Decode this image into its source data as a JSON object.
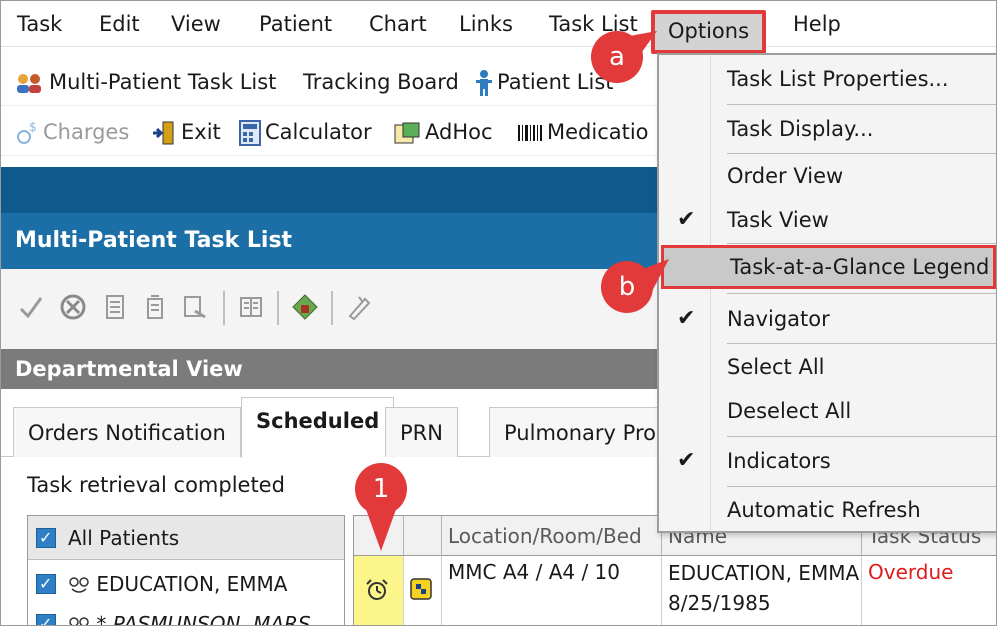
{
  "menubar": {
    "items": [
      "Task",
      "Edit",
      "View",
      "Patient",
      "Chart",
      "Links",
      "Task List",
      "Options",
      "Help"
    ]
  },
  "toolbar1": {
    "multi_patient": "Multi-Patient Task List",
    "tracking_board": "Tracking Board",
    "patient_list": "Patient List"
  },
  "toolbar2": {
    "charges": "Charges",
    "exit": "Exit",
    "calculator": "Calculator",
    "adhoc": "AdHoc",
    "medication": "Medicatio"
  },
  "title_bar": {
    "title": "Multi-Patient Task List"
  },
  "dept_bar": {
    "title": "Departmental View"
  },
  "tabs": [
    "Orders Notification",
    "Scheduled",
    "PRN",
    "Pulmonary Pro"
  ],
  "status": "Task retrieval completed",
  "patients": {
    "all_label": "All Patients",
    "rows": [
      {
        "name": "EDUCATION, EMMA",
        "italic": false
      },
      {
        "name": "* PASMUNSON, MARS",
        "italic": true
      }
    ]
  },
  "grid": {
    "headers": [
      "",
      "",
      "Location/Room/Bed",
      "Name",
      "Task Status"
    ],
    "row": {
      "location": "MMC A4 / A4 / 10",
      "name_line1": "EDUCATION, EMMA",
      "name_line2": "8/25/1985",
      "status": "Overdue"
    }
  },
  "options_menu": {
    "items": [
      {
        "label": "Task List Properties...",
        "checked": false
      },
      {
        "label": "Task Display...",
        "checked": false
      },
      {
        "label": "Order View",
        "checked": false
      },
      {
        "label": "Task View",
        "checked": true
      },
      {
        "label": "Task-at-a-Glance Legend",
        "checked": false
      },
      {
        "label": "Navigator",
        "checked": true
      },
      {
        "label": "Select All",
        "checked": false
      },
      {
        "label": "Deselect All",
        "checked": false
      },
      {
        "label": "Indicators",
        "checked": true
      },
      {
        "label": "Automatic Refresh",
        "checked": false
      }
    ]
  },
  "callouts": {
    "a": "a",
    "b": "b",
    "one": "1"
  },
  "colors": {
    "callout_red": "#e23a3a",
    "title_blue": "#1b6fa6",
    "top_blue": "#0f5a8c",
    "overdue_red": "#e01d1d"
  }
}
